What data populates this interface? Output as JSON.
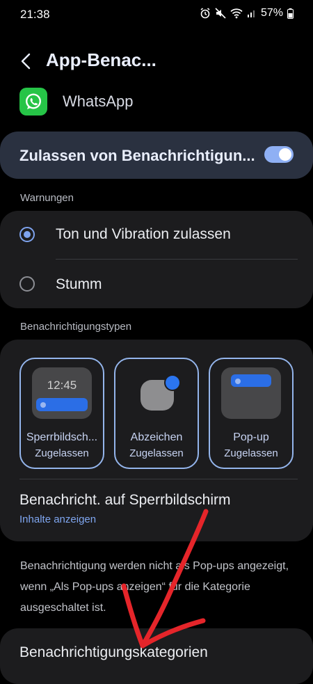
{
  "status_bar": {
    "time": "21:38",
    "battery": "57%"
  },
  "header": {
    "title": "App-Benac..."
  },
  "app": {
    "name": "WhatsApp"
  },
  "allow_notifications": {
    "label": "Zulassen von Benachrichtigun...",
    "enabled": true
  },
  "warnings": {
    "section_label": "Warnungen",
    "options": [
      {
        "label": "Ton und Vibration zulassen",
        "selected": true
      },
      {
        "label": "Stumm",
        "selected": false
      }
    ]
  },
  "notification_types": {
    "section_label": "Benachrichtigungstypen",
    "tiles": [
      {
        "name": "Sperrbildsch...",
        "status": "Zugelassen",
        "preview_time": "12:45"
      },
      {
        "name": "Abzeichen",
        "status": "Zugelassen"
      },
      {
        "name": "Pop-up",
        "status": "Zugelassen"
      }
    ],
    "lockscreen": {
      "title": "Benachricht. auf Sperrbildschirm",
      "subtitle": "Inhalte anzeigen"
    }
  },
  "info_text": "Benachrichtigung werden nicht als Pop-ups angezeigt, wenn „Als Pop-ups anzeigen“ für die Kategorie ausgeschaltet ist.",
  "categories": {
    "label": "Benachrichtigungskategorien"
  },
  "colors": {
    "accent": "#7ea3ee",
    "annotation": "#e5252a",
    "whatsapp": "#26c447"
  }
}
